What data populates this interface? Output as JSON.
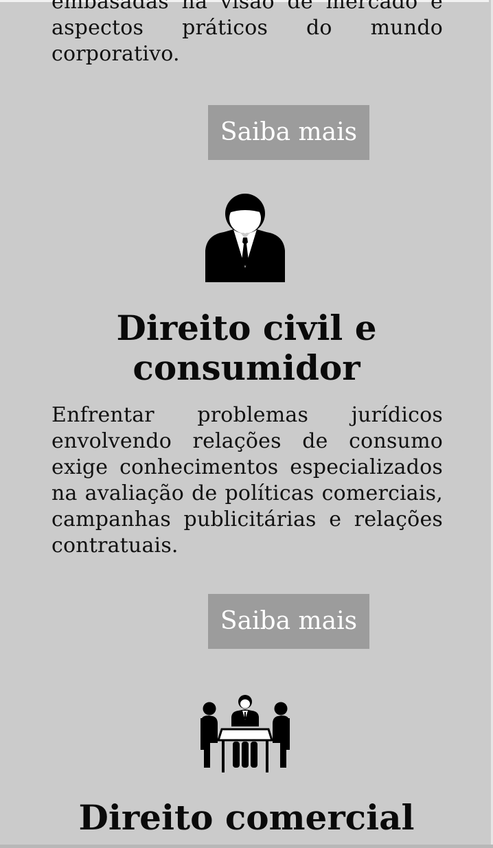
{
  "sections": {
    "intro_text": "embasadas na visão de mercado e aspectos práticos do mundo corporativo.",
    "button_1_label": "Saiba mais",
    "civil": {
      "title": "Direito civil e consumidor",
      "text": "Enfrentar problemas jurídicos envolvendo relações de consumo exige conhecimentos especializados na avaliação de políticas comerciais, campanhas publicitárias e relações contratuais.",
      "button_label": "Saiba mais",
      "icon": "lawyer-person-icon"
    },
    "comercial": {
      "title": "Direito comercial",
      "icon": "business-meeting-icon"
    }
  },
  "colors": {
    "background": "#cbcbcb",
    "button": "#9c9c9c",
    "button_text": "#ffffff",
    "text": "#111111"
  }
}
